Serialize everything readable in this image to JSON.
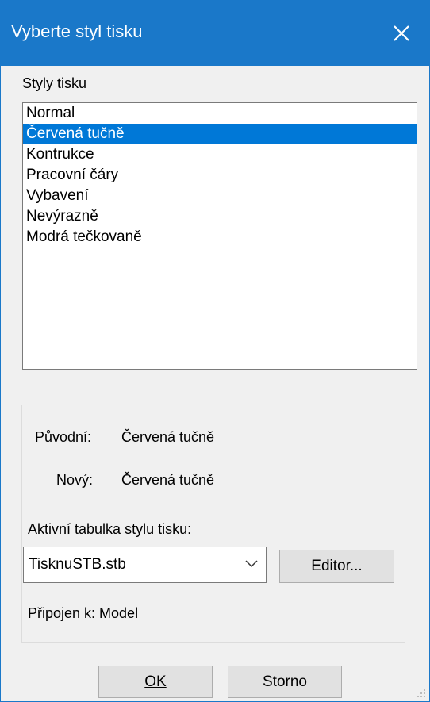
{
  "title": "Vyberte styl tisku",
  "list_label": "Styly tisku",
  "styles": [
    "Normal",
    "Červená tučně",
    "Kontrukce",
    "Pracovní čáry",
    "Vybavení",
    "Nevýrazně",
    "Modrá tečkovaně"
  ],
  "selected_index": 1,
  "original_label": "Původní:",
  "original_value": "Červená tučně",
  "new_label": "Nový:",
  "new_value": "Červená tučně",
  "table_label": "Aktivní tabulka stylu tisku:",
  "table_value": "TisknuSTB.stb",
  "editor_button": "Editor...",
  "attached_text": "Připojen k: Model",
  "ok_button": "OK",
  "cancel_button": "Storno",
  "colors": {
    "titlebar": "#1a78c9",
    "selection": "#0078d7"
  }
}
